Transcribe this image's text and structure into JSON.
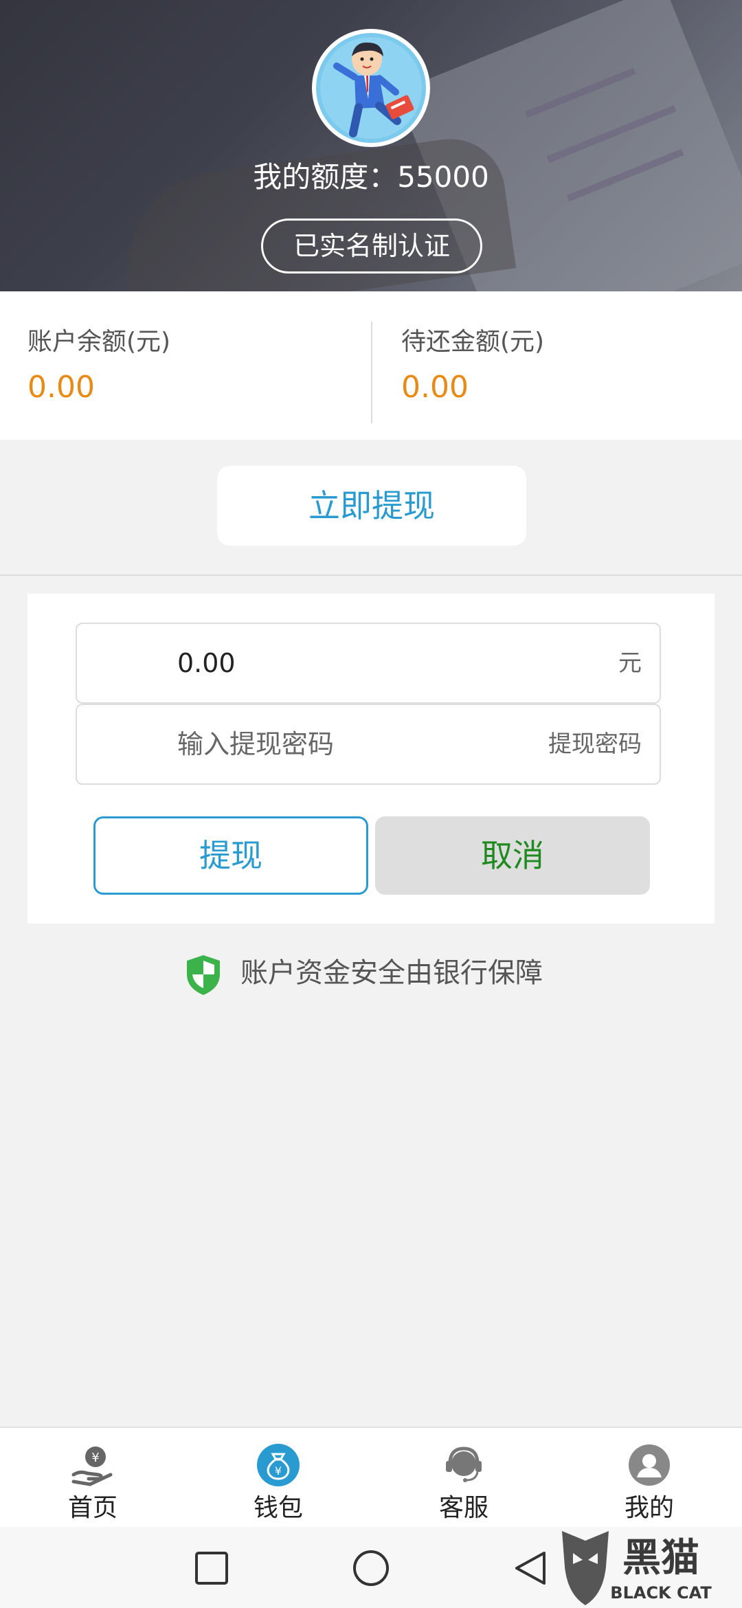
{
  "header": {
    "quota_label": "我的额度：55000",
    "verify_label": "已实名制认证"
  },
  "balances": {
    "account_label": "账户余额(元)",
    "account_value": "0.00",
    "due_label": "待还金额(元)",
    "due_value": "0.00"
  },
  "withdraw_now_label": "立即提现",
  "form": {
    "amount_value": "0.00",
    "amount_suffix": "元",
    "password_placeholder": "输入提现密码",
    "password_suffix": "提现密码",
    "withdraw_label": "提现",
    "cancel_label": "取消"
  },
  "security_text": "账户资金安全由银行保障",
  "tabs": [
    {
      "label": "首页",
      "icon": "home-money-hand-icon",
      "active": false
    },
    {
      "label": "钱包",
      "icon": "wallet-moneybag-icon",
      "active": true
    },
    {
      "label": "客服",
      "icon": "customer-service-icon",
      "active": false
    },
    {
      "label": "我的",
      "icon": "profile-icon",
      "active": false
    }
  ],
  "watermark": {
    "brand_cn": "黑猫",
    "brand_en": "BLACK CAT"
  },
  "colors": {
    "accent_blue": "#2a9bd0",
    "amount_orange": "#e98a16",
    "cancel_green": "#1f8a1f",
    "shield_green": "#3bb34a"
  }
}
